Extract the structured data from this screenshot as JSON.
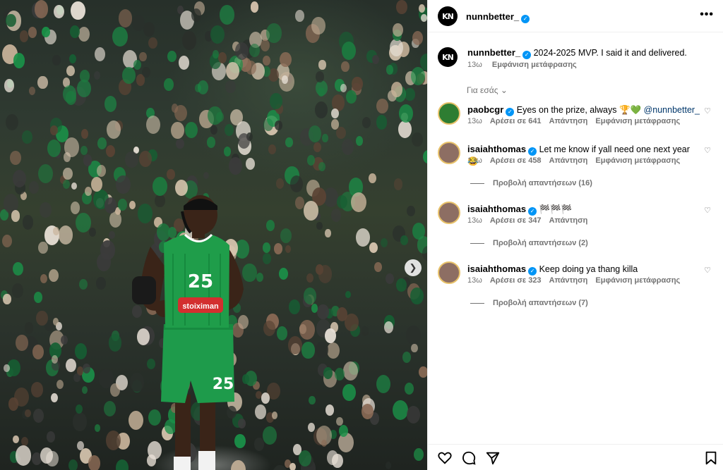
{
  "post": {
    "author": "nunnbetter_",
    "author_logo": "KN",
    "caption": "2024-2025 MVP. I said it and delivered.",
    "caption_age": "13ω",
    "caption_translate": "Εμφάνιση μετάφρασης",
    "filter_label": "Για εσάς"
  },
  "photo": {
    "jersey_number": "25",
    "sponsor": "stoiximan",
    "colors": {
      "jersey": "#1f9d4a",
      "crowd": "#2f3a31"
    }
  },
  "comments": [
    {
      "user": "paobcgr",
      "text": "Eyes on the prize, always 🏆💚",
      "mention": "@nunnbetter_",
      "age": "13ω",
      "likes": "Αρέσει σε 641",
      "reply": "Απάντηση",
      "translate": "Εμφάνιση μετάφρασης",
      "view_replies": ""
    },
    {
      "user": "isaiahthomas",
      "text": "Let me know if yall need one next year 😂",
      "mention": "",
      "age": "13ω",
      "likes": "Αρέσει σε 458",
      "reply": "Απάντηση",
      "translate": "Εμφάνιση μετάφρασης",
      "view_replies": "Προβολή απαντήσεων (16)"
    },
    {
      "user": "isaiahthomas",
      "text": "🏁🏁🏁",
      "mention": "",
      "age": "13ω",
      "likes": "Αρέσει σε 347",
      "reply": "Απάντηση",
      "translate": "",
      "view_replies": "Προβολή απαντήσεων (2)"
    },
    {
      "user": "isaiahthomas",
      "text": "Keep doing ya thang killa",
      "mention": "",
      "age": "13ω",
      "likes": "Αρέσει σε 323",
      "reply": "Απάντηση",
      "translate": "Εμφάνιση μετάφρασης",
      "view_replies": "Προβολή απαντήσεων (7)"
    }
  ],
  "icons": {
    "more": "more-options-icon",
    "like": "heart-icon",
    "comment": "comment-icon",
    "share": "share-icon",
    "save": "bookmark-icon",
    "next": "chevron-right-icon"
  },
  "accent": {
    "verified": "#0095f6",
    "muted": "#737373",
    "link": "#00376b"
  }
}
